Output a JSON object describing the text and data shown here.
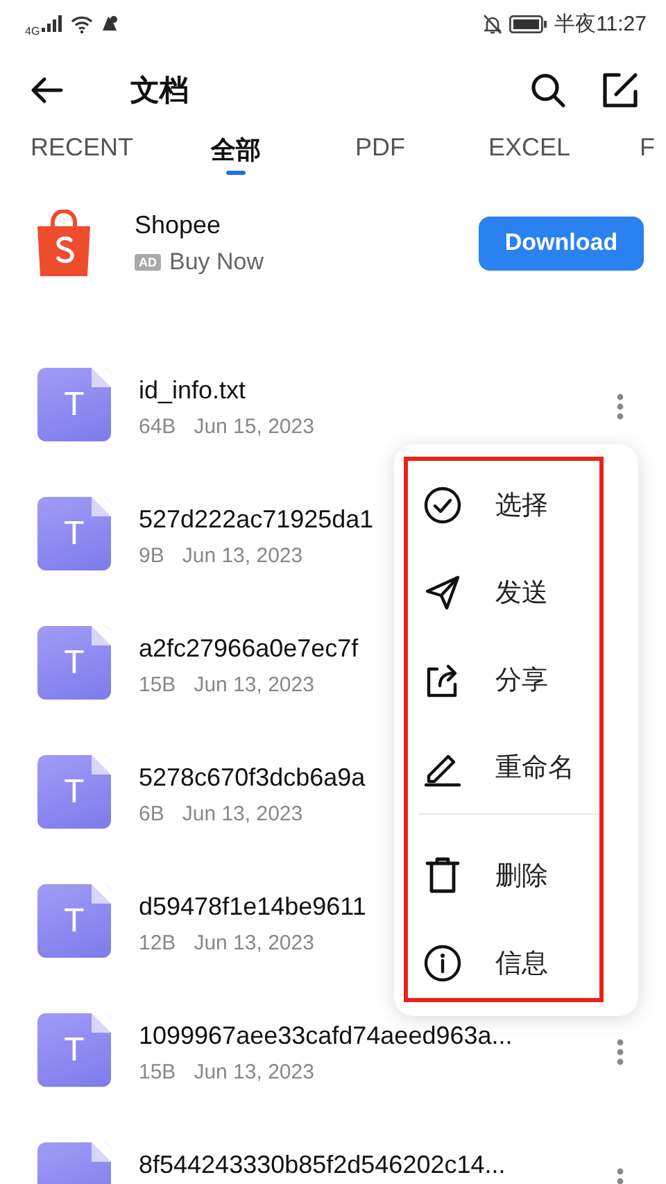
{
  "status_bar": {
    "network": "4G",
    "time": "半夜11:27"
  },
  "header": {
    "title": "文档"
  },
  "tabs": [
    {
      "label": "RECENT",
      "selected": false
    },
    {
      "label": "全部",
      "selected": true
    },
    {
      "label": "PDF",
      "selected": false
    },
    {
      "label": "EXCEL",
      "selected": false
    },
    {
      "label": "F",
      "selected": false
    }
  ],
  "ad": {
    "name": "Shopee",
    "badge": "AD",
    "subtitle": "Buy Now",
    "button": "Download"
  },
  "files": [
    {
      "letter": "T",
      "name": "id_info.txt",
      "size": "64B",
      "date": "Jun 15, 2023",
      "more_button": true
    },
    {
      "letter": "T",
      "name": "527d222ac71925da1",
      "size": "9B",
      "date": "Jun 13, 2023",
      "more_button": false
    },
    {
      "letter": "T",
      "name": "a2fc27966a0e7ec7f",
      "size": "15B",
      "date": "Jun 13, 2023",
      "more_button": false
    },
    {
      "letter": "T",
      "name": "5278c670f3dcb6a9a",
      "size": "6B",
      "date": "Jun 13, 2023",
      "more_button": false
    },
    {
      "letter": "T",
      "name": "d59478f1e14be9611",
      "size": "12B",
      "date": "Jun 13, 2023",
      "more_button": false
    },
    {
      "letter": "T",
      "name": "1099967aee33cafd74aeed963a...",
      "size": "15B",
      "date": "Jun 13, 2023",
      "more_button": true
    },
    {
      "name": "8f544243330b85f2d546202c14...",
      "more_button": true
    }
  ],
  "context_menu": {
    "items": [
      {
        "kind": "select",
        "label": "选择",
        "divider_before": false
      },
      {
        "kind": "send",
        "label": "发送",
        "divider_before": false
      },
      {
        "kind": "share",
        "label": "分享",
        "divider_before": false
      },
      {
        "kind": "rename",
        "label": "重命名",
        "divider_before": false
      },
      {
        "kind": "delete",
        "label": "删除",
        "divider_before": true
      },
      {
        "kind": "info",
        "label": "信息",
        "divider_before": false
      }
    ]
  }
}
